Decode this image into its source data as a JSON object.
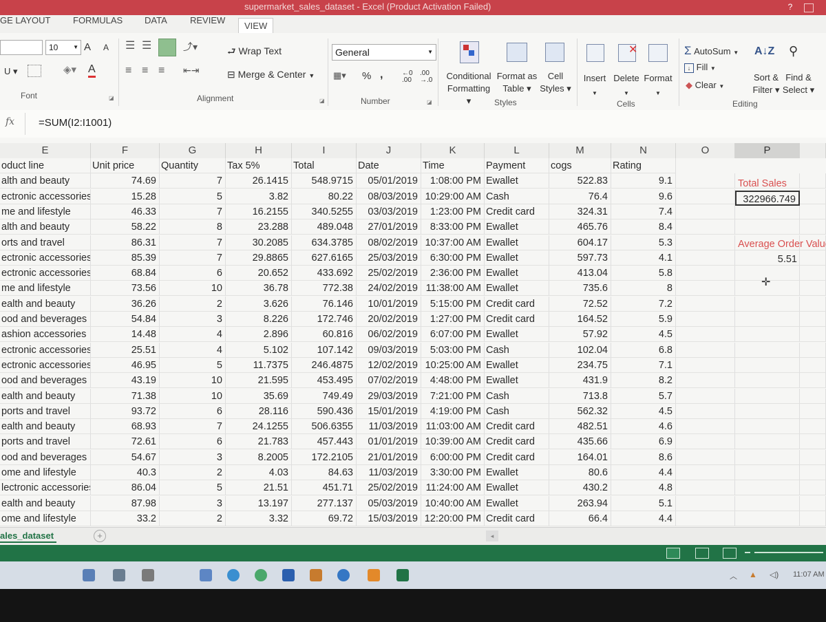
{
  "window": {
    "title": "supermarket_sales_dataset -  Excel (Product Activation Failed)",
    "help": "?",
    "restore_icon": "restore-icon"
  },
  "ribbon_tabs": [
    "GE LAYOUT",
    "FORMULAS",
    "DATA",
    "REVIEW",
    "VIEW"
  ],
  "ribbon": {
    "font": {
      "label": "Font",
      "size": "10",
      "grow": "A",
      "shrink": "A"
    },
    "alignment": {
      "label": "Alignment",
      "wrap_text": "Wrap Text",
      "merge_center": "Merge & Center"
    },
    "number": {
      "label": "Number",
      "format": "General",
      "percent": "%",
      "comma": ",",
      "inc_dec": "←0 .00",
      "dec_dec": ".00 →.0"
    },
    "styles": {
      "label": "Styles",
      "conditional_1": "Conditional",
      "conditional_2": "Formatting",
      "format_as_1": "Format as",
      "format_as_2": "Table",
      "cell_1": "Cell",
      "cell_2": "Styles"
    },
    "cells": {
      "label": "Cells",
      "insert": "Insert",
      "delete": "Delete",
      "format": "Format"
    },
    "editing": {
      "label": "Editing",
      "autosum": "AutoSum",
      "fill": "Fill",
      "clear": "Clear",
      "sort_1": "Sort &",
      "sort_2": "Filter",
      "find_1": "Find &",
      "find_2": "Select"
    }
  },
  "formula_bar": {
    "fx": "fx",
    "formula": "=SUM(I2:I1001)"
  },
  "columns": [
    "E",
    "F",
    "G",
    "H",
    "I",
    "J",
    "K",
    "L",
    "M",
    "N",
    "O",
    "P"
  ],
  "headers": [
    "oduct line",
    "Unit price",
    "Quantity",
    "Tax 5%",
    "Total",
    "Date",
    "Time",
    "Payment",
    "cogs",
    "Rating"
  ],
  "rows": [
    [
      "alth and beauty",
      "74.69",
      "7",
      "26.1415",
      "548.9715",
      "05/01/2019",
      "1:08:00 PM",
      "Ewallet",
      "522.83",
      "9.1"
    ],
    [
      "ectronic accessories",
      "15.28",
      "5",
      "3.82",
      "80.22",
      "08/03/2019",
      "10:29:00 AM",
      "Cash",
      "76.4",
      "9.6"
    ],
    [
      "me and lifestyle",
      "46.33",
      "7",
      "16.2155",
      "340.5255",
      "03/03/2019",
      "1:23:00 PM",
      "Credit card",
      "324.31",
      "7.4"
    ],
    [
      "alth and beauty",
      "58.22",
      "8",
      "23.288",
      "489.048",
      "27/01/2019",
      "8:33:00 PM",
      "Ewallet",
      "465.76",
      "8.4"
    ],
    [
      "orts and travel",
      "86.31",
      "7",
      "30.2085",
      "634.3785",
      "08/02/2019",
      "10:37:00 AM",
      "Ewallet",
      "604.17",
      "5.3"
    ],
    [
      "ectronic accessories",
      "85.39",
      "7",
      "29.8865",
      "627.6165",
      "25/03/2019",
      "6:30:00 PM",
      "Ewallet",
      "597.73",
      "4.1"
    ],
    [
      "ectronic accessories",
      "68.84",
      "6",
      "20.652",
      "433.692",
      "25/02/2019",
      "2:36:00 PM",
      "Ewallet",
      "413.04",
      "5.8"
    ],
    [
      "me and lifestyle",
      "73.56",
      "10",
      "36.78",
      "772.38",
      "24/02/2019",
      "11:38:00 AM",
      "Ewallet",
      "735.6",
      "8"
    ],
    [
      "ealth and beauty",
      "36.26",
      "2",
      "3.626",
      "76.146",
      "10/01/2019",
      "5:15:00 PM",
      "Credit card",
      "72.52",
      "7.2"
    ],
    [
      "ood and beverages",
      "54.84",
      "3",
      "8.226",
      "172.746",
      "20/02/2019",
      "1:27:00 PM",
      "Credit card",
      "164.52",
      "5.9"
    ],
    [
      "ashion accessories",
      "14.48",
      "4",
      "2.896",
      "60.816",
      "06/02/2019",
      "6:07:00 PM",
      "Ewallet",
      "57.92",
      "4.5"
    ],
    [
      "ectronic accessories",
      "25.51",
      "4",
      "5.102",
      "107.142",
      "09/03/2019",
      "5:03:00 PM",
      "Cash",
      "102.04",
      "6.8"
    ],
    [
      "ectronic accessories",
      "46.95",
      "5",
      "11.7375",
      "246.4875",
      "12/02/2019",
      "10:25:00 AM",
      "Ewallet",
      "234.75",
      "7.1"
    ],
    [
      "ood and beverages",
      "43.19",
      "10",
      "21.595",
      "453.495",
      "07/02/2019",
      "4:48:00 PM",
      "Ewallet",
      "431.9",
      "8.2"
    ],
    [
      "ealth and beauty",
      "71.38",
      "10",
      "35.69",
      "749.49",
      "29/03/2019",
      "7:21:00 PM",
      "Cash",
      "713.8",
      "5.7"
    ],
    [
      "ports and travel",
      "93.72",
      "6",
      "28.116",
      "590.436",
      "15/01/2019",
      "4:19:00 PM",
      "Cash",
      "562.32",
      "4.5"
    ],
    [
      "ealth and beauty",
      "68.93",
      "7",
      "24.1255",
      "506.6355",
      "11/03/2019",
      "11:03:00 AM",
      "Credit card",
      "482.51",
      "4.6"
    ],
    [
      "ports and travel",
      "72.61",
      "6",
      "21.783",
      "457.443",
      "01/01/2019",
      "10:39:00 AM",
      "Credit card",
      "435.66",
      "6.9"
    ],
    [
      "ood and beverages",
      "54.67",
      "3",
      "8.2005",
      "172.2105",
      "21/01/2019",
      "6:00:00 PM",
      "Credit card",
      "164.01",
      "8.6"
    ],
    [
      "ome and lifestyle",
      "40.3",
      "2",
      "4.03",
      "84.63",
      "11/03/2019",
      "3:30:00 PM",
      "Ewallet",
      "80.6",
      "4.4"
    ],
    [
      "lectronic accessories",
      "86.04",
      "5",
      "21.51",
      "451.71",
      "25/02/2019",
      "11:24:00 AM",
      "Ewallet",
      "430.2",
      "4.8"
    ],
    [
      "ealth and beauty",
      "87.98",
      "3",
      "13.197",
      "277.137",
      "05/03/2019",
      "10:40:00 AM",
      "Ewallet",
      "263.94",
      "5.1"
    ],
    [
      "ome and lifestyle",
      "33.2",
      "2",
      "3.32",
      "69.72",
      "15/03/2019",
      "12:20:00 PM",
      "Credit card",
      "66.4",
      "4.4"
    ]
  ],
  "summary": {
    "total_sales_label": "Total Sales",
    "total_sales_value": "322966.749",
    "avg_order_label": "Average Order Value",
    "avg_order_value": "5.51"
  },
  "sheet_tab": "ales_dataset",
  "add_sheet": "+",
  "clock": "11:07 AM",
  "colors": {
    "title_bar": "#c8424a",
    "status_bar": "#217346",
    "red_label": "#d95050"
  }
}
